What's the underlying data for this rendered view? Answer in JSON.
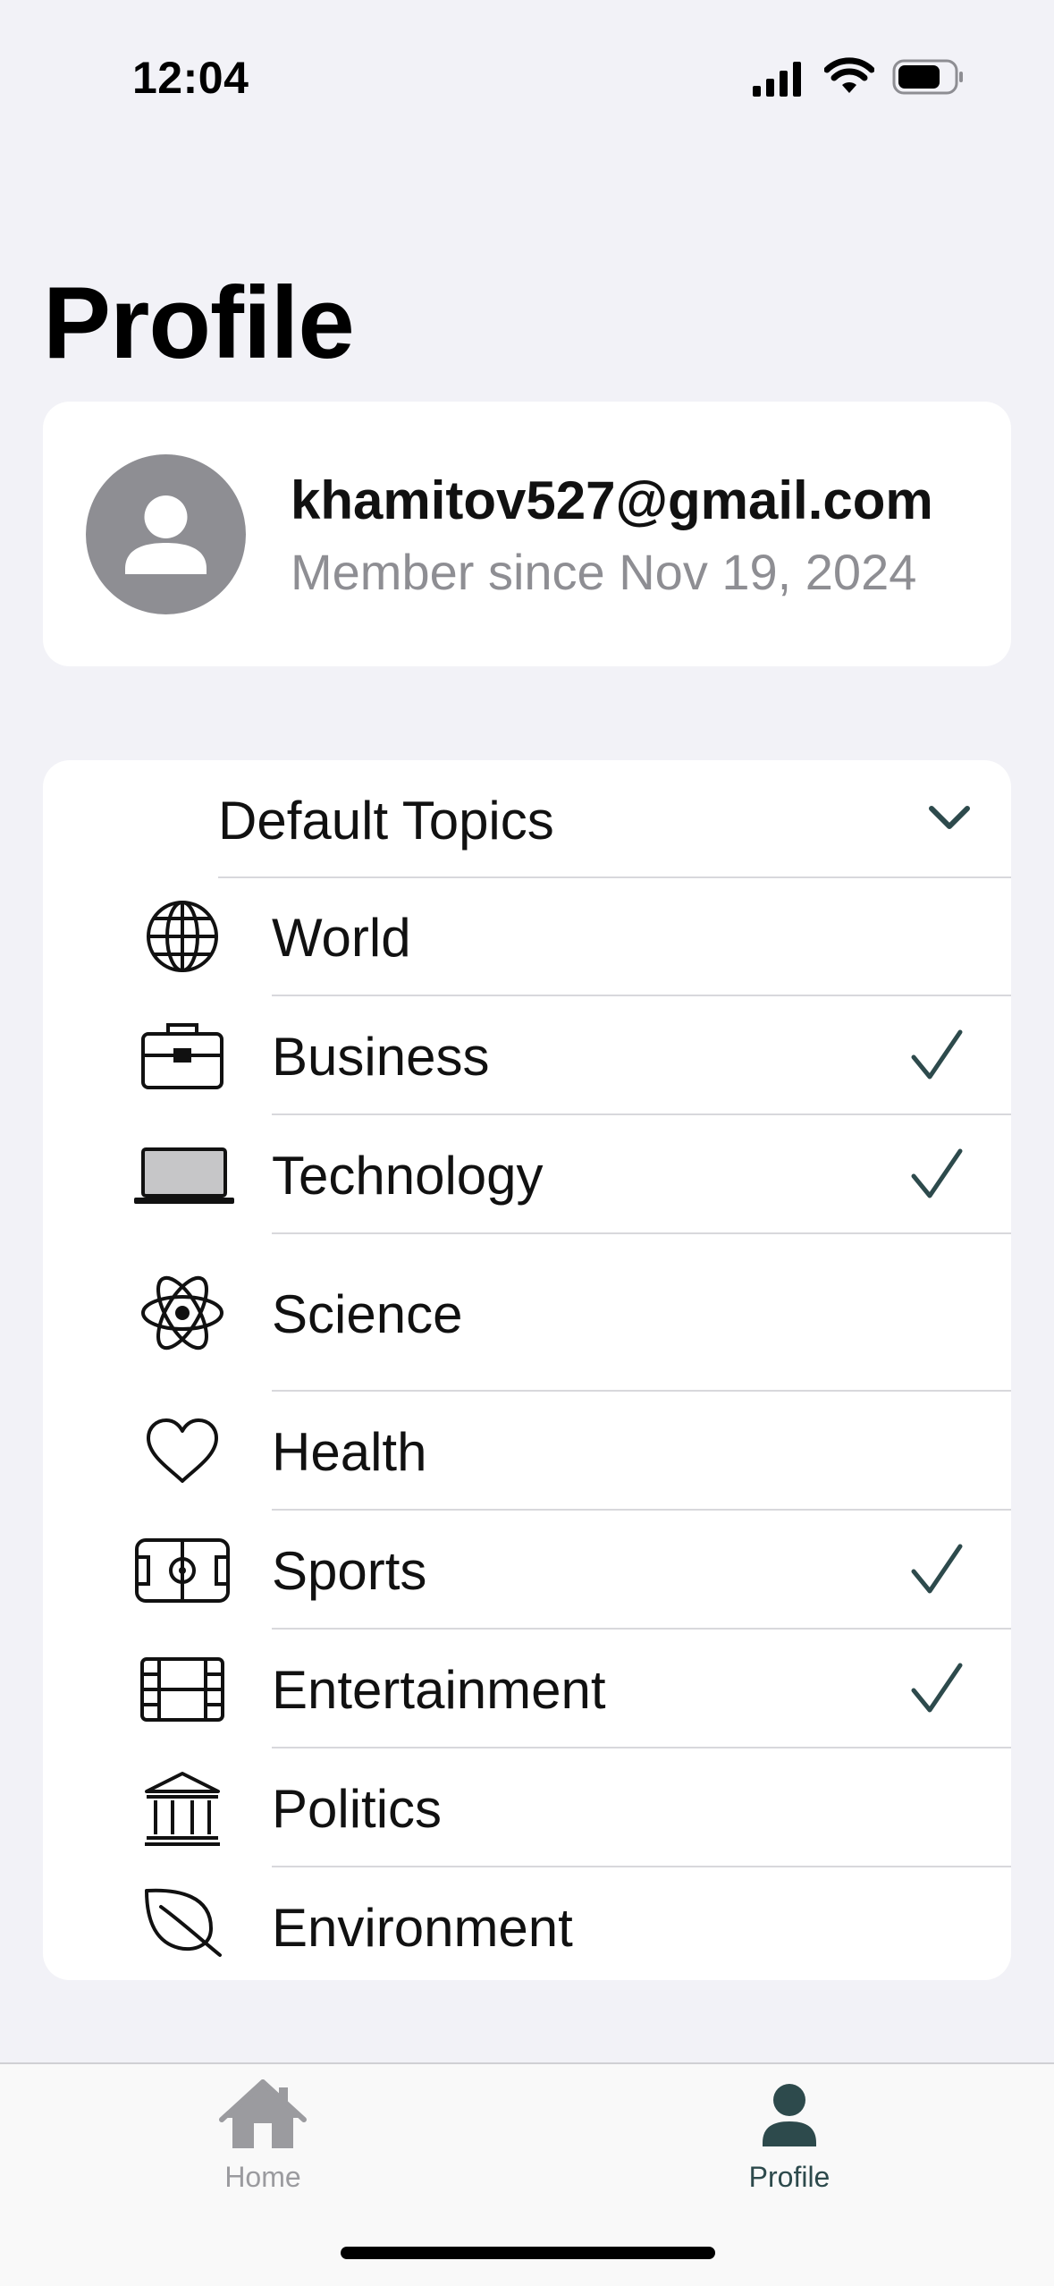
{
  "status_bar": {
    "time": "12:04"
  },
  "header": {
    "title": "Profile"
  },
  "profile": {
    "email": "khamitov527@gmail.com",
    "member_since": "Member since Nov 19, 2024"
  },
  "topics": {
    "header_label": "Default Topics",
    "items": [
      {
        "label": "World",
        "icon": "globe-icon",
        "selected": false
      },
      {
        "label": "Business",
        "icon": "briefcase-icon",
        "selected": true
      },
      {
        "label": "Technology",
        "icon": "laptop-icon",
        "selected": true
      },
      {
        "label": "Science",
        "icon": "atom-icon",
        "selected": false
      },
      {
        "label": "Health",
        "icon": "heart-icon",
        "selected": false
      },
      {
        "label": "Sports",
        "icon": "sports-field-icon",
        "selected": true
      },
      {
        "label": "Entertainment",
        "icon": "film-icon",
        "selected": true
      },
      {
        "label": "Politics",
        "icon": "building-columns-icon",
        "selected": false
      },
      {
        "label": "Environment",
        "icon": "leaf-icon",
        "selected": false
      }
    ]
  },
  "tab_bar": {
    "tabs": [
      {
        "label": "Home",
        "icon": "house-icon",
        "active": false
      },
      {
        "label": "Profile",
        "icon": "person-icon",
        "active": true
      }
    ]
  },
  "colors": {
    "accent": "#2d4a4c",
    "background": "#f2f2f7",
    "secondary_text": "#8e8e93"
  }
}
